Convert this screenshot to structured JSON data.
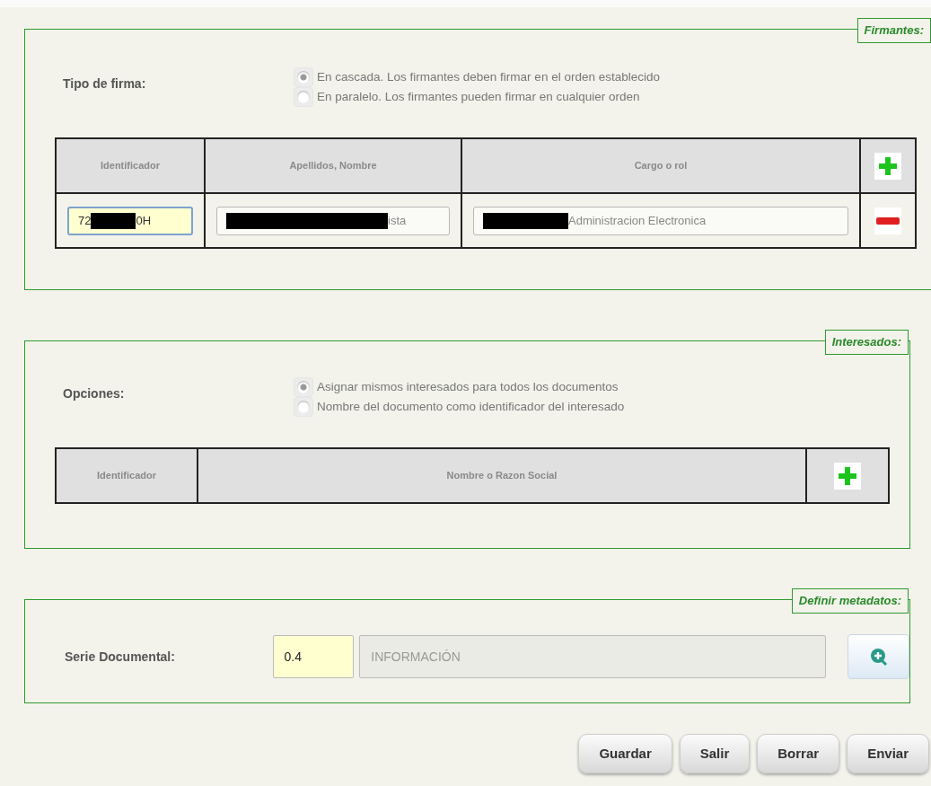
{
  "firmantes": {
    "legend": "Firmantes:",
    "label": "Tipo de firma:",
    "options": [
      {
        "label": "En cascada. Los firmantes deben firmar en el orden establecido",
        "selected": true
      },
      {
        "label": "En paralelo. Los firmantes pueden firmar en cualquier orden",
        "selected": false
      }
    ],
    "table": {
      "columns": [
        "Identificador",
        "Apellidos, Nombre",
        "Cargo o rol"
      ],
      "rows": [
        {
          "cells": [
            {
              "before": "72",
              "after": "0H",
              "redacted": true,
              "focused": true
            },
            {
              "after": "ista",
              "redacted": true,
              "focused": false
            },
            {
              "after": "Administracion Electronica",
              "redacted": true,
              "focused": false
            }
          ]
        }
      ]
    }
  },
  "interesados": {
    "legend": "Interesados:",
    "label": "Opciones:",
    "options": [
      {
        "label": "Asignar mismos interesados para todos los documentos",
        "selected": true
      },
      {
        "label": "Nombre del documento como identificador del interesado",
        "selected": false
      }
    ],
    "table": {
      "columns": [
        "Identificador",
        "Nombre o Razon Social"
      ]
    }
  },
  "metadatos": {
    "legend": "Definir metadatos:",
    "label": "Serie Documental:",
    "code": "0.4",
    "description": "INFORMACIÓN"
  },
  "buttons": [
    "Guardar",
    "Salir",
    "Borrar",
    "Enviar"
  ]
}
